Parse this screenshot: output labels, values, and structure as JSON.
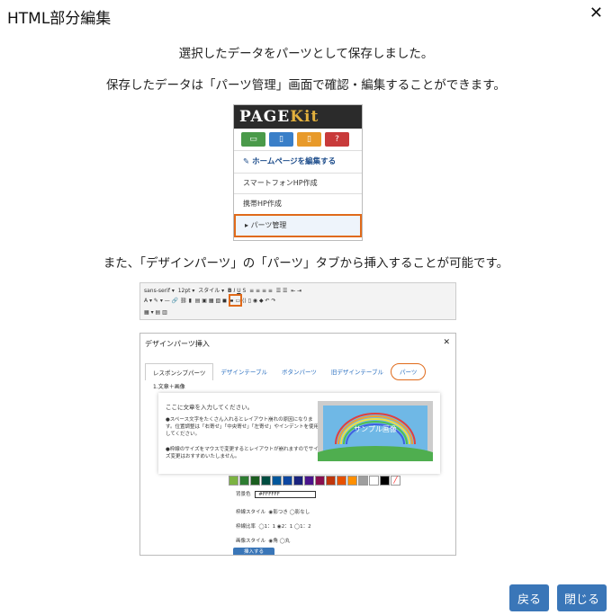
{
  "dialog": {
    "title": "HTML部分編集",
    "message1": "選択したデータをパーツとして保存しました。",
    "message2": "保存したデータは「パーツ管理」画面で確認・編集することができます。",
    "message3": "また、「デザインパーツ」の「パーツ」タブから挿入することが可能です。",
    "back_button": "戻る",
    "close_button": "閉じる",
    "accent_color": "#3a76b8"
  },
  "pagekit_panel": {
    "logo": "PAGEKit",
    "menu_edit": "ホームページを編集する",
    "menu_smartphone": "スマートフォンHP作成",
    "menu_mobile": "携帯HP作成",
    "menu_parts": "パーツ管理"
  },
  "toolbar": {
    "font": "sans-serif",
    "size": "12pt",
    "style": "スタイル"
  },
  "design_parts": {
    "title": "デザインパーツ挿入",
    "tabs": [
      "レスポンシブパーツ",
      "デザインテーブル",
      "ボタンパーツ",
      "旧デザインテーブル",
      "パーツ"
    ],
    "section": "1.文章＋画像",
    "card_line1": "ここに文章を入力してください。",
    "card_line2": "●スペース文字をたくさん入れるとレイアウト崩れの原因になります。位置調整は「右寄せ」「中央寄せ」「左寄せ」やインデントを使用してください。",
    "card_line3": "●枠線のサイズをマウスで変更するとレイアウトが崩れますのでサイズ変更はおすすめいたしません。",
    "sample_image_label": "サンプル画像",
    "bg_label": "背景色",
    "bg_value": "#FFFFFF",
    "border_style_label": "枠線スタイル",
    "border_style_value": "◉影つき ◯影なし",
    "ratio_label": "枠線比率",
    "ratio_value": "◯1：1 ◉2：1 ◯1：2",
    "image_style_label": "画像スタイル",
    "image_style_value": "◉角 ◯丸",
    "insert_button": "挿入する"
  }
}
